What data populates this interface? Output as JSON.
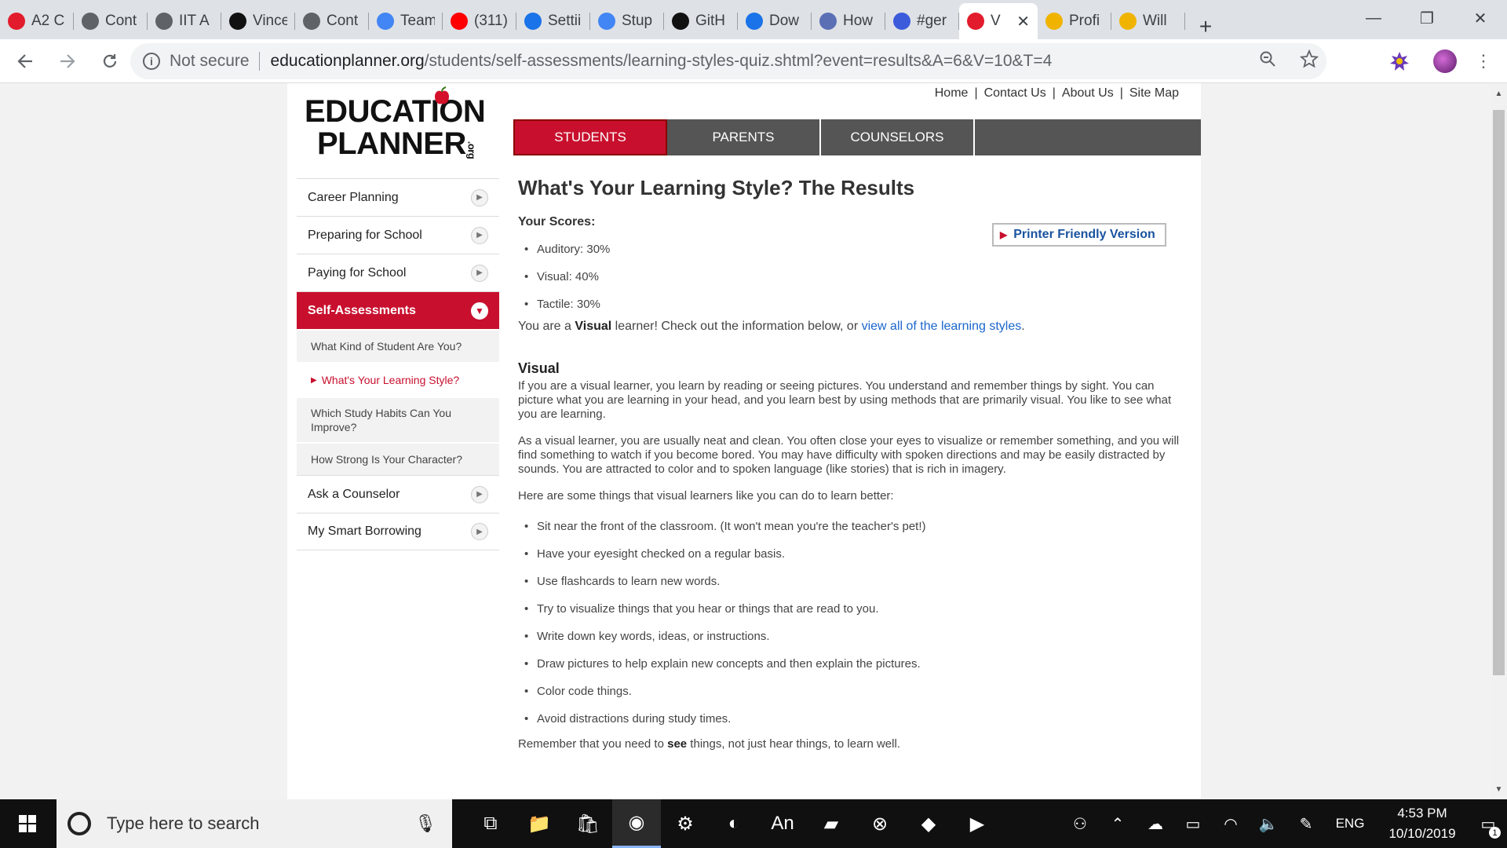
{
  "browser": {
    "tabs": [
      {
        "label": "A2 C",
        "icon": "red-logo-icon",
        "color": "#e21c2c"
      },
      {
        "label": "Cont",
        "icon": "globe-icon",
        "color": "#5f6368"
      },
      {
        "label": "IIT A",
        "icon": "globe-icon",
        "color": "#5f6368"
      },
      {
        "label": "Vince",
        "icon": "github-icon",
        "color": "#111111"
      },
      {
        "label": "Cont",
        "icon": "globe-icon",
        "color": "#5f6368"
      },
      {
        "label": "Team",
        "icon": "docs-icon",
        "color": "#4285f4"
      },
      {
        "label": "(311)",
        "icon": "youtube-icon",
        "color": "#ff0000"
      },
      {
        "label": "Settii",
        "icon": "gear-icon",
        "color": "#1a73e8"
      },
      {
        "label": "Stup",
        "icon": "docs-icon",
        "color": "#4285f4"
      },
      {
        "label": "GitH",
        "icon": "github-icon",
        "color": "#111111"
      },
      {
        "label": "Dow",
        "icon": "download-icon",
        "color": "#1a73e8"
      },
      {
        "label": "How",
        "icon": "brain-icon",
        "color": "#5b6fb5"
      },
      {
        "label": "#ger",
        "icon": "notification-icon",
        "color": "#3b5bdb"
      },
      {
        "label": "V",
        "icon": "apple-icon",
        "color": "#e21c2c",
        "active": true
      },
      {
        "label": "Profi",
        "icon": "dots-icon",
        "color": "#f0b400"
      },
      {
        "label": "Will",
        "icon": "dots-icon",
        "color": "#f0b400"
      }
    ],
    "new_tab": "+",
    "window_controls": {
      "minimize": "—",
      "maximize": "❐",
      "close": "✕"
    },
    "security": "Not secure",
    "url_host": "educationplanner.org",
    "url_path": "/students/self-assessments/learning-styles-quiz.shtml?event=results&A=6&V=10&T=4"
  },
  "page": {
    "logo": {
      "line1": "EDUCATION",
      "line2": "PLANNER",
      "suffix": ".org"
    },
    "top_links": [
      "Home",
      "Contact Us",
      "About Us",
      "Site Map"
    ],
    "main_nav": [
      {
        "label": "STUDENTS",
        "active": true
      },
      {
        "label": "PARENTS"
      },
      {
        "label": "COUNSELORS"
      }
    ],
    "sidebar": {
      "items": [
        {
          "label": "Career Planning"
        },
        {
          "label": "Preparing for School"
        },
        {
          "label": "Paying for School"
        },
        {
          "label": "Self-Assessments",
          "selected": true
        },
        {
          "label": "Ask a Counselor"
        },
        {
          "label": "My Smart Borrowing"
        }
      ],
      "sub_items": [
        {
          "label": "What Kind of Student Are You?"
        },
        {
          "label": "What's Your Learning Style?",
          "current": true
        },
        {
          "label": "Which Study Habits Can You Improve?"
        },
        {
          "label": "How Strong Is Your Character?"
        }
      ]
    },
    "content": {
      "title": "What's Your Learning Style? The Results",
      "scores_header": "Your Scores:",
      "printer_link": "Printer Friendly Version",
      "scores": [
        "Auditory: 30%",
        "Visual: 40%",
        "Tactile: 30%"
      ],
      "summary_pre": "You are a ",
      "summary_bold": "Visual",
      "summary_mid": " learner! Check out the information below, or ",
      "summary_link": "view all of the learning styles",
      "summary_post": ".",
      "section_title": "Visual",
      "para1": "If you are a visual learner, you learn by reading or seeing pictures. You understand and remember things by sight. You can picture what you are learning in your head, and you learn best by using methods that are primarily visual. You like to see what you are learning.",
      "para2": "As a visual learner, you are usually neat and clean. You often close your eyes to visualize or remember something, and you will find something to watch if you become bored. You may have difficulty with spoken directions and may be easily distracted by sounds. You are attracted to color and to spoken language (like stories) that is rich in imagery.",
      "para3": "Here are some things that visual learners like you can do to learn better:",
      "tips": [
        "Sit near the front of the classroom. (It won't mean you're the teacher's pet!)",
        "Have your eyesight checked on a regular basis.",
        "Use flashcards to learn new words.",
        "Try to visualize things that you hear or things that are read to you.",
        "Write down key words, ideas, or instructions.",
        "Draw pictures to help explain new concepts and then explain the pictures.",
        "Color code things.",
        "Avoid distractions during study times."
      ],
      "closing_pre": "Remember that you need to ",
      "closing_bold": "see",
      "closing_post": " things, not just hear things, to learn well."
    }
  },
  "taskbar": {
    "search_placeholder": "Type here to search",
    "apps": [
      "task-view-icon",
      "file-explorer-icon",
      "store-icon",
      "chrome-icon",
      "settings-icon",
      "eclipse-icon",
      "animate-icon",
      "sticky-notes-icon",
      "cex-icon",
      "git-icon",
      "media-player-icon"
    ],
    "language": "ENG",
    "time": "4:53 PM",
    "date": "10/10/2019",
    "notification_count": "1"
  }
}
